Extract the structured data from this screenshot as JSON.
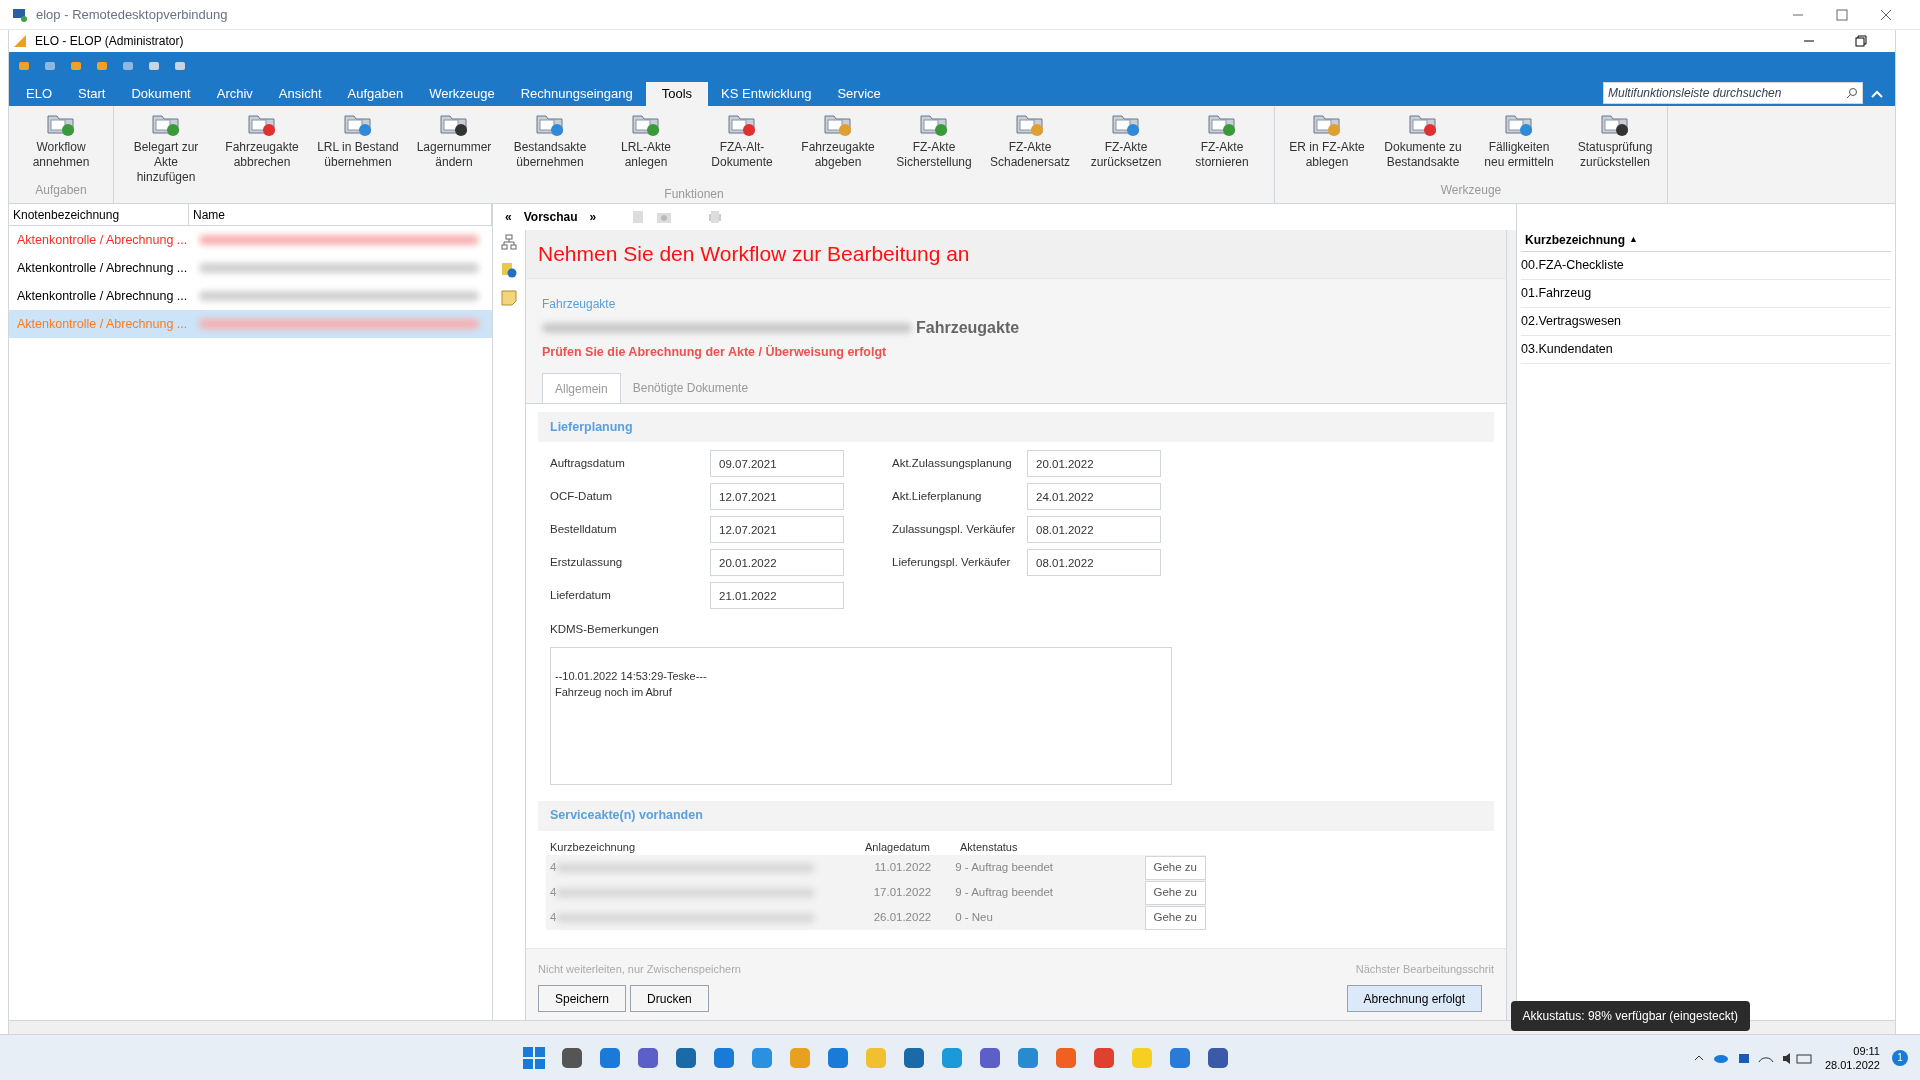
{
  "rdp_window": {
    "title": "elop - Remotedesktopverbindung"
  },
  "app_window": {
    "title": "ELO - ELOP (Administrator)"
  },
  "ribbon_tabs": [
    {
      "label": "ELO",
      "selected": false
    },
    {
      "label": "Start",
      "selected": false
    },
    {
      "label": "Dokument",
      "selected": false
    },
    {
      "label": "Archiv",
      "selected": false
    },
    {
      "label": "Ansicht",
      "selected": false
    },
    {
      "label": "Aufgaben",
      "selected": false
    },
    {
      "label": "Werkzeuge",
      "selected": false
    },
    {
      "label": "Rechnungseingang",
      "selected": false
    },
    {
      "label": "Tools",
      "selected": true
    },
    {
      "label": "KS Entwicklung",
      "selected": false
    },
    {
      "label": "Service",
      "selected": false
    }
  ],
  "ribbon_search": {
    "placeholder": "Multifunktionsleiste durchsuchen"
  },
  "ribbon_groups": [
    {
      "label": "Aufgaben",
      "buttons": [
        {
          "label": "Workflow annehmen",
          "color": "#3a9a3a"
        }
      ]
    },
    {
      "label": "Funktionen",
      "buttons": [
        {
          "label": "Belegart zur Akte hinzufügen",
          "color": "#3a9a3a"
        },
        {
          "label": "Fahrzeugakte abbrechen",
          "color": "#e03030"
        },
        {
          "label": "LRL in Bestand übernehmen",
          "color": "#2f8ad8"
        },
        {
          "label": "Lagernummer ändern",
          "color": "#333333"
        },
        {
          "label": "Bestandsakte übernehmen",
          "color": "#2f8ad8"
        },
        {
          "label": "LRL-Akte anlegen",
          "color": "#3a9a3a"
        },
        {
          "label": "FZA-Alt-Dokumente",
          "color": "#e03030"
        },
        {
          "label": "Fahrzeugakte abgeben",
          "color": "#e0a030"
        },
        {
          "label": "FZ-Akte Sicherstellung",
          "color": "#3a9a3a"
        },
        {
          "label": "FZ-Akte Schadenersatz",
          "color": "#e0a030"
        },
        {
          "label": "FZ-Akte zurücksetzen",
          "color": "#2f8ad8"
        },
        {
          "label": "FZ-Akte stornieren",
          "color": "#3a9a3a"
        }
      ]
    },
    {
      "label": "Werkzeuge",
      "buttons": [
        {
          "label": "ER in FZ-Akte ablegen",
          "color": "#e0a030"
        },
        {
          "label": "Dokumente zu Bestandsakte",
          "color": "#e03030"
        },
        {
          "label": "Fälligkeiten neu ermitteln",
          "color": "#2f8ad8"
        },
        {
          "label": "Statusprüfung zurückstellen",
          "color": "#333333"
        }
      ]
    }
  ],
  "task_list": {
    "columns": [
      "Knotenbezeichnung",
      "Name"
    ],
    "rows": [
      {
        "node": "Aktenkontrolle / Abrechnung ...",
        "color": "#ff2a2a",
        "selected": false
      },
      {
        "node": "Aktenkontrolle / Abrechnung ...",
        "color": "#000000",
        "selected": false
      },
      {
        "node": "Aktenkontrolle / Abrechnung ...",
        "color": "#000000",
        "selected": false
      },
      {
        "node": "Aktenkontrolle / Abrechnung ...",
        "color": "#ff7a1a",
        "selected": true
      }
    ]
  },
  "preview": {
    "label": "Vorschau",
    "collapse": "«",
    "expand": "»",
    "heading": "Nehmen Sie den Workflow zur Bearbeitung an",
    "record_type": "Fahrzeugakte",
    "record_title_suffix": "Fahrzeugakte",
    "instruction": "Prüfen Sie die Abrechnung der Akte / Überweisung erfolgt",
    "tabs": [
      {
        "label": "Allgemein",
        "selected": true
      },
      {
        "label": "Benötigte Dokumente",
        "selected": false
      }
    ],
    "section_delivery": "Lieferplanung",
    "fields_left": [
      {
        "label": "Auftragsdatum",
        "value": "09.07.2021"
      },
      {
        "label": "OCF-Datum",
        "value": "12.07.2021"
      },
      {
        "label": "Bestelldatum",
        "value": "12.07.2021"
      },
      {
        "label": "Erstzulassung",
        "value": "20.01.2022"
      },
      {
        "label": "Lieferdatum",
        "value": "21.01.2022"
      }
    ],
    "fields_right": [
      {
        "label": "Akt.Zulassungsplanung",
        "value": "20.01.2022"
      },
      {
        "label": "Akt.Lieferplanung",
        "value": "24.01.2022"
      },
      {
        "label": "Zulassungspl. Verkäufer",
        "value": "08.01.2022"
      },
      {
        "label": "Lieferungspl. Verkäufer",
        "value": "08.01.2022"
      }
    ],
    "remarks": {
      "label": "KDMS-Bemerkungen",
      "lines": [
        "--10.01.2022 14:53:29-Teske---",
        "Fahrzeug noch im Abruf"
      ]
    },
    "section_service": "Serviceakte(n) vorhanden",
    "service_columns": [
      "Kurzbezeichnung",
      "Anlagedatum",
      "Aktenstatus"
    ],
    "service_rows": [
      {
        "prefix": "4",
        "date": "11.01.2022",
        "status": "9 - Auftrag beendet",
        "action": "Gehe zu"
      },
      {
        "prefix": "4",
        "date": "17.01.2022",
        "status": "9 - Auftrag beendet",
        "action": "Gehe zu"
      },
      {
        "prefix": "4",
        "date": "26.01.2022",
        "status": "0 - Neu",
        "action": "Gehe zu"
      }
    ],
    "footer_left_hint": "Nicht weiterleiten, nur Zwischenspeichern",
    "footer_right_hint": "Nächster Bearbeitungsschrit",
    "buttons_left": [
      "Speichern",
      "Drucken"
    ],
    "button_right": "Abrechnung erfolgt"
  },
  "documents": {
    "column": "Kurzbezeichnung",
    "sort": "▲",
    "items": [
      "00.FZA-Checkliste",
      "01.Fahrzeug",
      "02.Vertragswesen",
      "03.Kundendaten"
    ]
  },
  "battery_tooltip": "Akkustatus: 98% verfügbar (eingesteckt)",
  "taskbar": {
    "time": "09:11",
    "date": "28.01.2022",
    "notifications": "1"
  }
}
